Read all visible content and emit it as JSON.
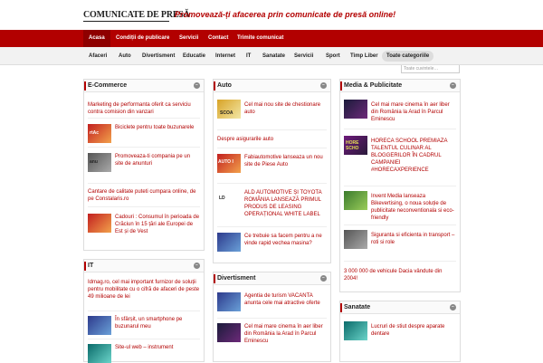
{
  "header": {
    "logo": "COMUNICATE DE PRESĂ",
    "tagline": "Promovează-ți afacerea prin comunicate de presă online!"
  },
  "nav_main": [
    "Acasa",
    "Condiții de publicare",
    "Servicii",
    "Contact",
    "Trimite comunicat"
  ],
  "search": {
    "placeholder": "Toate cuvintele…"
  },
  "nav_sub": [
    "Afaceri",
    "Auto",
    "Divertisment",
    "Educatie",
    "Internet",
    "IT",
    "Sanatate",
    "Servicii",
    "Sport",
    "Timp Liber",
    "Toate categoriile"
  ],
  "boxes": {
    "ecommerce": {
      "title": "E-Commerce",
      "items": [
        "Marketing de performanta oferit ca serviciu contra comision din vanzari",
        "Biciclete pentru toate buzunarele",
        "Promoveaza-ti compania pe un site de anunturi",
        "Cantare de calitate puteti cumpara online, de pe Constalaris.ro",
        "Cadouri : Consumul în perioada de Crăciun în 15 țări ale Europei de Est și de Vest"
      ]
    },
    "it": {
      "title": "IT",
      "items": [
        "Idmag.ro, cel mai important furnizor de soluții pentru mobilitate cu o cifră de afaceri de peste 49 milioane de lei",
        "În sfârșit, un smartphone pe buzunarul meu",
        "Site-ul web – instrument"
      ]
    },
    "auto": {
      "title": "Auto",
      "items": [
        "Cel mai nou site de chestionare auto",
        "Despre asigurarile auto",
        "Fabiautomotive lanseaza un nou site de Piese Auto",
        "ALD AUTOMOTIVE ȘI TOYOTA ROMÂNIA LANSEAZĂ PRIMUL PRODUS DE LEASING OPERAȚIONAL WHITE LABEL",
        "Ce trebuie sa facem pentru a ne vinde rapid vechea masina?"
      ]
    },
    "divertisment": {
      "title": "Divertisment",
      "items": [
        "Agentia de turism VACANTA anunta cele mai atractive oferte",
        "Cel mai mare cinema în aer liber din România la Arad în Parcul Eminescu"
      ]
    },
    "media": {
      "title": "Media & Publicitate",
      "items": [
        "Cel mai mare cinema în aer liber din România la Arad în Parcul Eminescu",
        "HORECA SCHOOL PREMIAZA TALENTUL CULINAR AL BLOGGERILOR ÎN CADRUL CAMPANIEI #HORECAXPERIENCE",
        "Invent Media lanseaza Bikevertising, o noua soluție de publicitate neconventionala si eco-friendly",
        "Siguranta si eficienta in transport – roti si role",
        "3 000 000 de vehicule Dacia vândute din 2004!"
      ]
    },
    "sanatate": {
      "title": "Sanatate",
      "items": [
        "Lucruri de stiut despre aparate dentare"
      ]
    }
  },
  "thumb_text": {
    "ecom1": "rtAc",
    "ecom2": "anu",
    "auto_scoala": "SCOA",
    "auto_fabi": "AUTO I",
    "ald": "LD",
    "horeca": "HORE SCHO"
  },
  "icons": {
    "toggle": "minus-circle-icon"
  }
}
